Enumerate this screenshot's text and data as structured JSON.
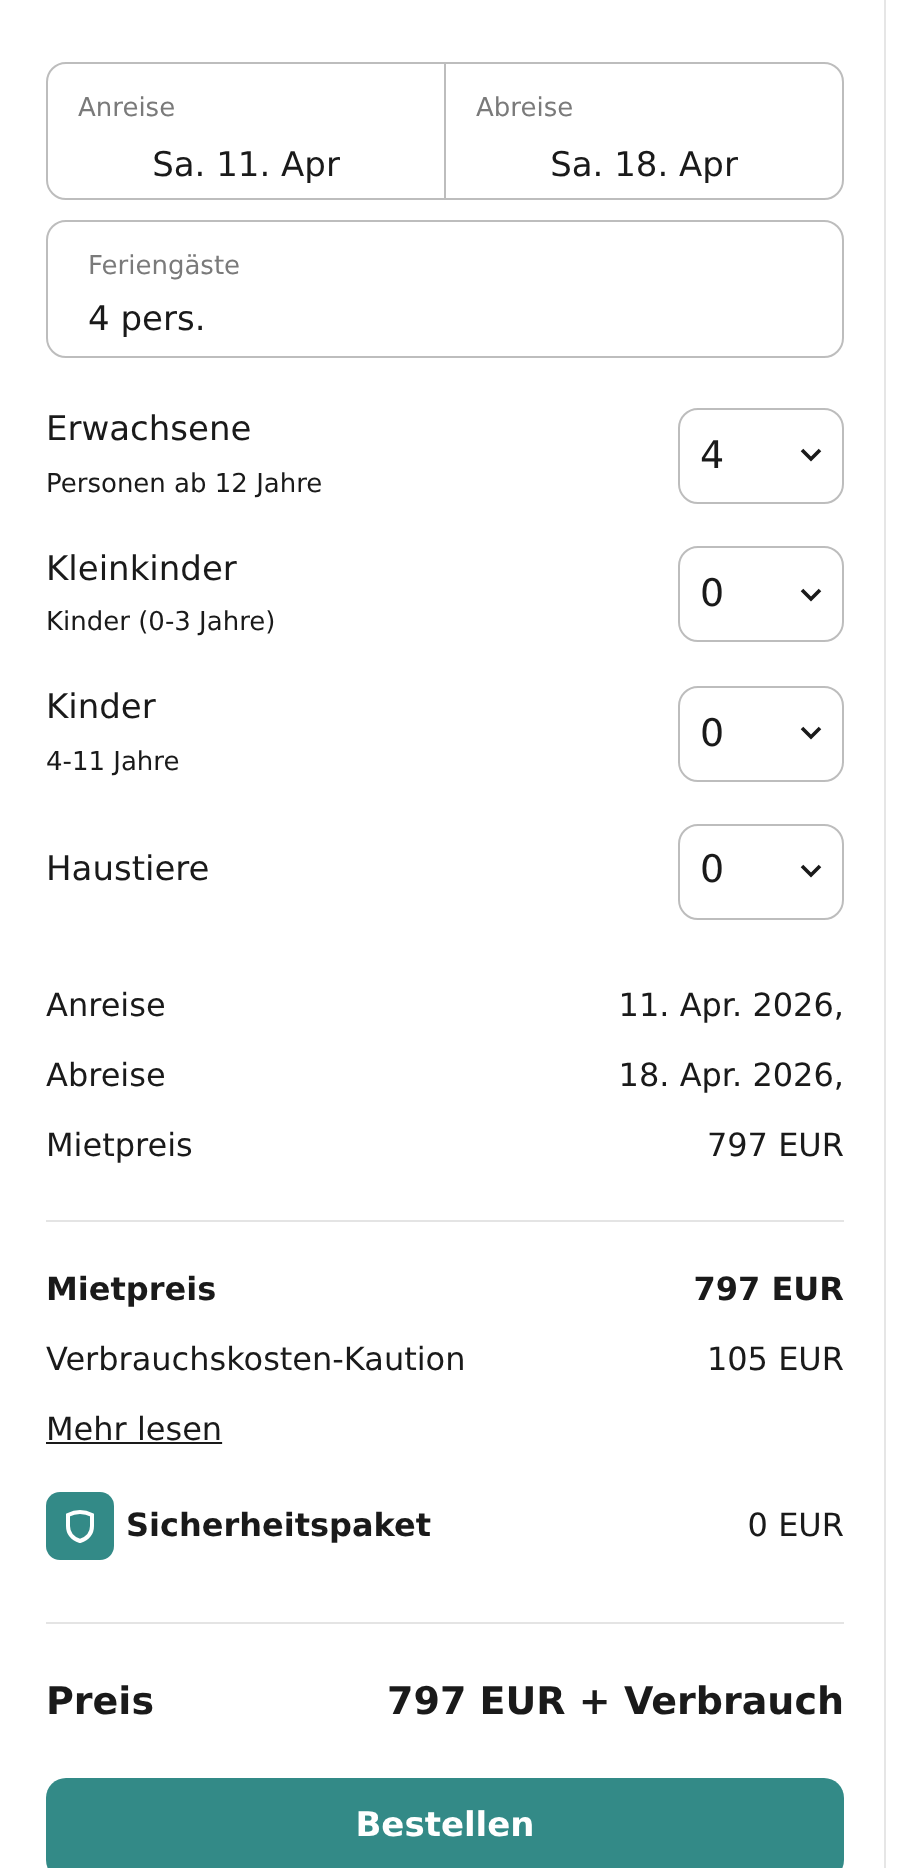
{
  "dates": [
    {
      "label": "Anreise",
      "value": "Sa. 11. Apr"
    },
    {
      "label": "Abreise",
      "value": "Sa. 18. Apr"
    }
  ],
  "guests": {
    "label": "Feriengäste",
    "value": "4 pers."
  },
  "counters": [
    {
      "label": "Erwachsene",
      "hint": "Personen ab 12 Jahre",
      "value": "4"
    },
    {
      "label": "Kleinkinder",
      "hint": "Kinder (0-3 Jahre)",
      "value": "0"
    },
    {
      "label": "Kinder",
      "hint": "4-11 Jahre",
      "value": "0"
    },
    {
      "label": "Haustiere",
      "value": "0"
    }
  ],
  "summary": [
    {
      "label": "Anreise",
      "value": "11. Apr. 2026,"
    },
    {
      "label": "Abreise",
      "value": "18. Apr. 2026,"
    },
    {
      "label": "Mietpreis",
      "value": "797 EUR"
    }
  ],
  "costs": [
    {
      "kind": "bold",
      "label": "Mietpreis",
      "value": "797 EUR"
    },
    {
      "kind": "normal",
      "label": "Verbrauchskosten-Kaution",
      "value": "105 EUR"
    },
    {
      "kind": "link",
      "label": "Mehr lesen"
    },
    {
      "kind": "package",
      "label": "Sicherheitspaket",
      "value": "0 EUR"
    }
  ],
  "total": {
    "label": "Preis",
    "value": "797 EUR + Verbrauch"
  },
  "order_button": "Bestellen"
}
